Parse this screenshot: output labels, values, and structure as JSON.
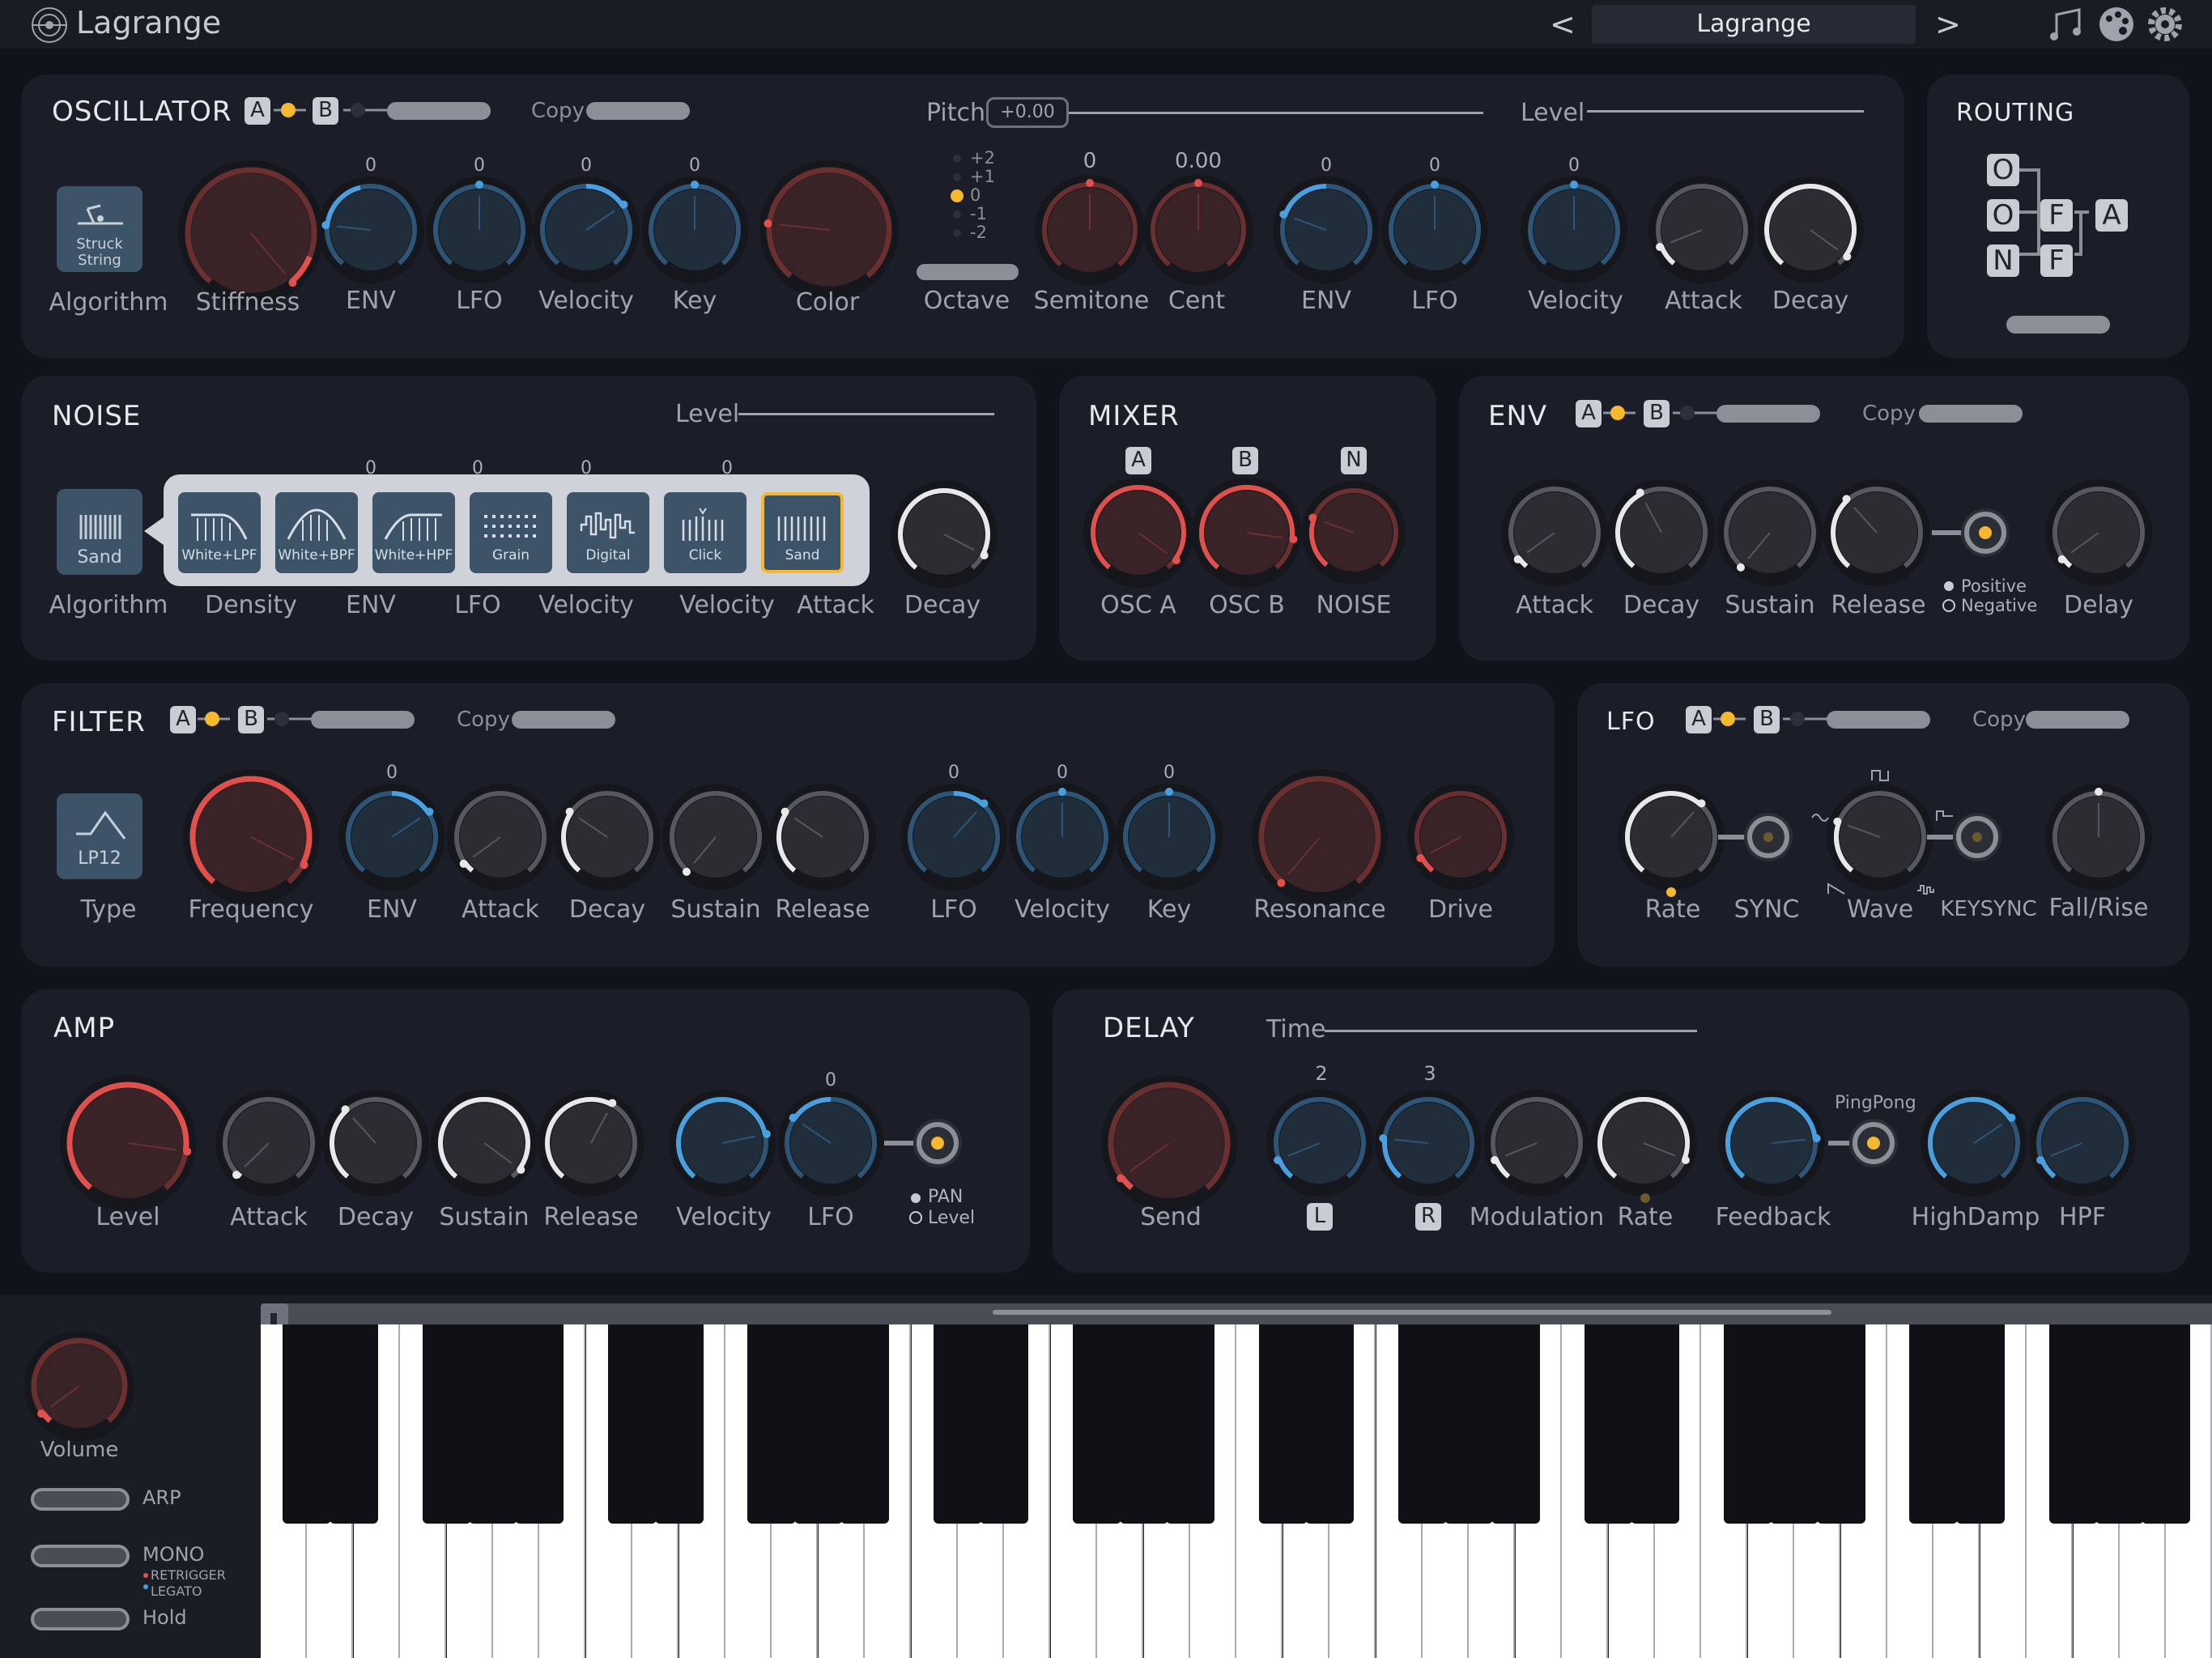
{
  "app": {
    "name": "Lagrange",
    "preset": "Lagrange",
    "prev": "<",
    "next": ">"
  },
  "osc": {
    "title": "OSCILLATOR",
    "ab": [
      "A",
      "B"
    ],
    "copy": "Copy",
    "pitch": "Pitch",
    "pitch_value": "+0.00",
    "level": "Level",
    "algorithm": "Algorithm",
    "algorithm_value": "Struck String",
    "knobs": [
      "Stiffness",
      "ENV",
      "LFO",
      "Velocity",
      "Key",
      "Color",
      "Octave",
      "Semitone",
      "Cent",
      "ENV",
      "LFO",
      "Velocity",
      "Attack",
      "Decay"
    ],
    "zero": "0",
    "cent_value": "0.00",
    "octave_steps": [
      "+2",
      "+1",
      "0",
      "-1",
      "-2"
    ]
  },
  "routing": {
    "title": "ROUTING",
    "nodes": [
      "O",
      "O",
      "N",
      "F",
      "F",
      "A"
    ]
  },
  "noise": {
    "title": "NOISE",
    "level": "Level",
    "algorithm": "Algorithm",
    "algorithm_value": "Sand",
    "knobs": [
      "Density",
      "ENV",
      "LFO",
      "Velocity",
      "Velocity",
      "Attack",
      "Decay"
    ],
    "types": [
      "White+LPF",
      "White+BPF",
      "White+HPF",
      "Grain",
      "Digital",
      "Click",
      "Sand"
    ],
    "zero": "0"
  },
  "mixer": {
    "title": "MIXER",
    "badges": [
      "A",
      "B",
      "N"
    ],
    "knobs": [
      "OSC A",
      "OSC B",
      "NOISE"
    ]
  },
  "env": {
    "title": "ENV",
    "ab": [
      "A",
      "B"
    ],
    "copy": "Copy",
    "knobs": [
      "Attack",
      "Decay",
      "Sustain",
      "Release",
      "Delay"
    ],
    "positive": "Positive",
    "negative": "Negative"
  },
  "filter": {
    "title": "FILTER",
    "ab": [
      "A",
      "B"
    ],
    "copy": "Copy",
    "type": "Type",
    "type_value": "LP12",
    "knobs": [
      "Frequency",
      "ENV",
      "Attack",
      "Decay",
      "Sustain",
      "Release",
      "LFO",
      "Velocity",
      "Key",
      "Resonance",
      "Drive"
    ],
    "zero": "0"
  },
  "lfo": {
    "title": "LFO",
    "ab": [
      "A",
      "B"
    ],
    "copy": "Copy",
    "knobs": [
      "Rate",
      "SYNC",
      "Wave",
      "KEYSYNC",
      "Fall/Rise"
    ]
  },
  "amp": {
    "title": "AMP",
    "knobs": [
      "Level",
      "Attack",
      "Decay",
      "Sustain",
      "Release",
      "Velocity",
      "LFO"
    ],
    "pan": "PAN",
    "lvl": "Level",
    "zero": "0"
  },
  "delay": {
    "title": "DELAY",
    "time": "Time",
    "knobs": [
      "Send",
      "Modulation",
      "Rate",
      "Feedback",
      "HighDamp",
      "HPF"
    ],
    "l": "L",
    "r": "R",
    "l_val": "2",
    "r_val": "3",
    "pingpong": "PingPong"
  },
  "side": {
    "volume": "Volume",
    "arp": "ARP",
    "mono": "MONO",
    "retrigger": "RETRIGGER",
    "legato": "LEGATO",
    "hold": "Hold"
  },
  "colors": {
    "bg": "#11131a",
    "panel": "#1b1e28",
    "red": "#e0504c",
    "blue": "#4a9fdf",
    "gold": "#f5b82e"
  }
}
